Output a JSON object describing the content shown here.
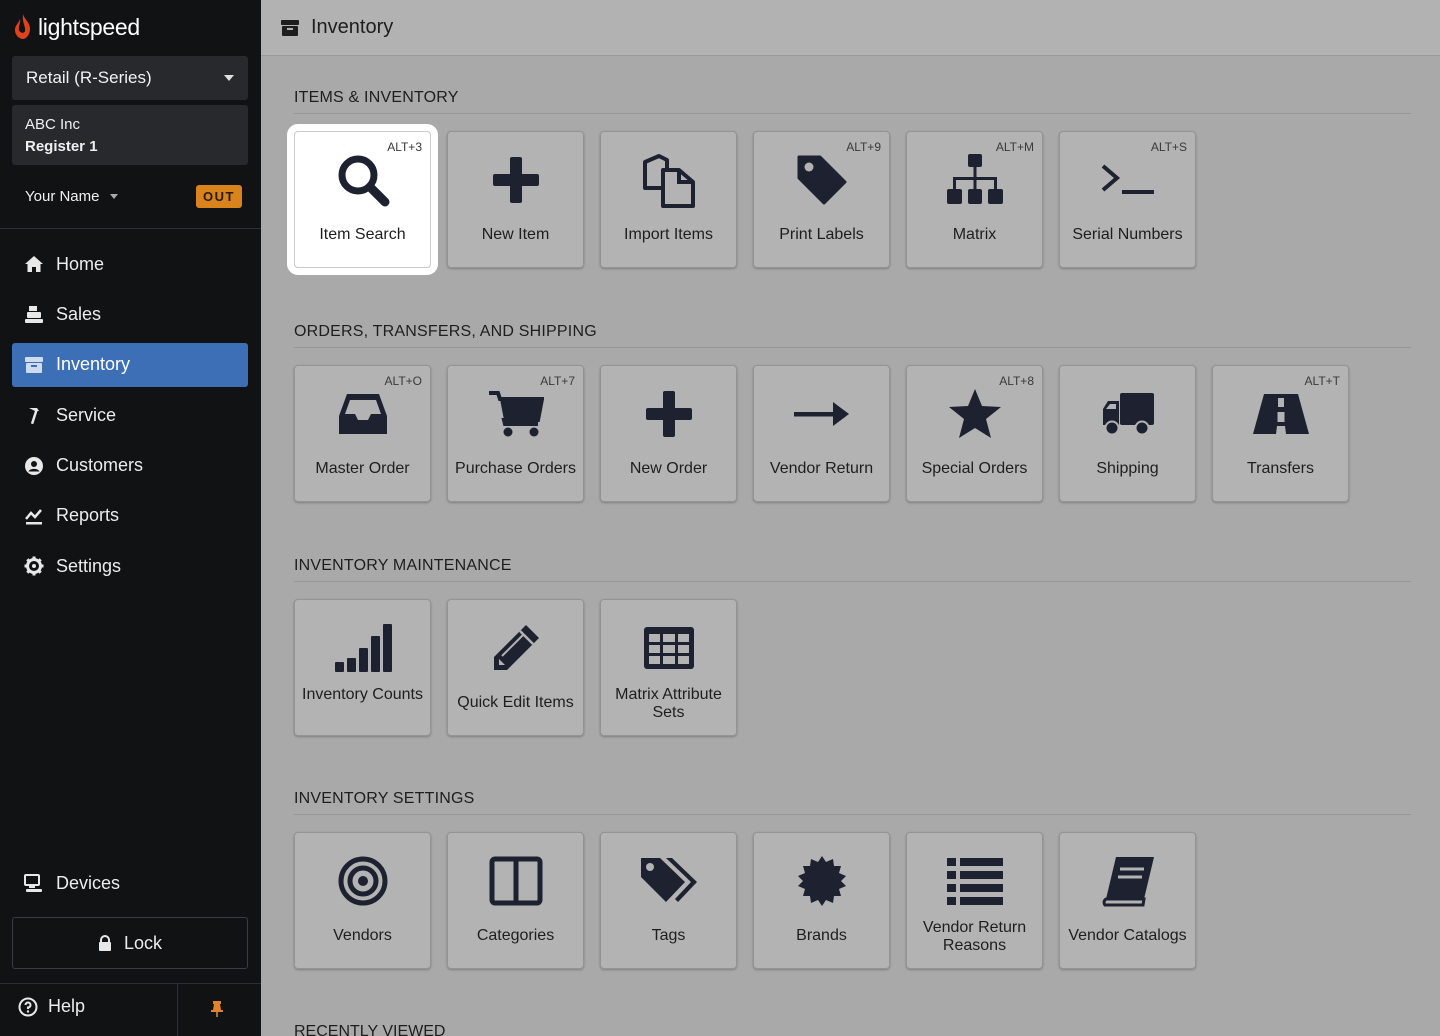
{
  "brand": {
    "name": "lightspeed",
    "accent": "#e0421e"
  },
  "sidebar": {
    "product": "Retail (R-Series)",
    "shop": "ABC Inc",
    "register": "Register 1",
    "user": "Your Name",
    "out_badge": "OUT",
    "nav": [
      {
        "label": "Home",
        "icon": "home-icon"
      },
      {
        "label": "Sales",
        "icon": "register-icon"
      },
      {
        "label": "Inventory",
        "icon": "box-icon",
        "active": true
      },
      {
        "label": "Service",
        "icon": "hammer-icon"
      },
      {
        "label": "Customers",
        "icon": "user-circle-icon"
      },
      {
        "label": "Reports",
        "icon": "chart-icon"
      },
      {
        "label": "Settings",
        "icon": "gear-icon"
      }
    ],
    "devices": "Devices",
    "lock": "Lock",
    "help": "Help"
  },
  "header": {
    "title": "Inventory"
  },
  "sections": [
    {
      "title": "ITEMS & INVENTORY",
      "tiles": [
        {
          "label": "Item Search",
          "shortcut": "ALT+3",
          "icon": "search-icon",
          "highlight": true
        },
        {
          "label": "New Item",
          "shortcut": "",
          "icon": "plus-icon"
        },
        {
          "label": "Import Items",
          "shortcut": "",
          "icon": "copy-icon"
        },
        {
          "label": "Print Labels",
          "shortcut": "ALT+9",
          "icon": "tag-icon"
        },
        {
          "label": "Matrix",
          "shortcut": "ALT+M",
          "icon": "sitemap-icon"
        },
        {
          "label": "Serial Numbers",
          "shortcut": "ALT+S",
          "icon": "terminal-icon"
        }
      ]
    },
    {
      "title": "ORDERS, TRANSFERS, AND SHIPPING",
      "tiles": [
        {
          "label": "Master Order",
          "shortcut": "ALT+O",
          "icon": "inbox-icon"
        },
        {
          "label": "Purchase Orders",
          "shortcut": "ALT+7",
          "icon": "cart-icon"
        },
        {
          "label": "New Order",
          "shortcut": "",
          "icon": "plus-icon"
        },
        {
          "label": "Vendor Return",
          "shortcut": "",
          "icon": "arrow-right-icon"
        },
        {
          "label": "Special Orders",
          "shortcut": "ALT+8",
          "icon": "star-icon"
        },
        {
          "label": "Shipping",
          "shortcut": "",
          "icon": "truck-icon"
        },
        {
          "label": "Transfers",
          "shortcut": "ALT+T",
          "icon": "road-icon"
        }
      ]
    },
    {
      "title": "INVENTORY MAINTENANCE",
      "tiles": [
        {
          "label": "Inventory Counts",
          "shortcut": "",
          "icon": "signal-icon"
        },
        {
          "label": "Quick Edit Items",
          "shortcut": "",
          "icon": "pencil-icon"
        },
        {
          "label": "Matrix Attribute Sets",
          "shortcut": "",
          "icon": "grid-icon"
        }
      ]
    },
    {
      "title": "INVENTORY SETTINGS",
      "tiles": [
        {
          "label": "Vendors",
          "shortcut": "",
          "icon": "target-icon"
        },
        {
          "label": "Categories",
          "shortcut": "",
          "icon": "columns-icon"
        },
        {
          "label": "Tags",
          "shortcut": "",
          "icon": "tags-icon"
        },
        {
          "label": "Brands",
          "shortcut": "",
          "icon": "certificate-icon"
        },
        {
          "label": "Vendor Return Reasons",
          "shortcut": "",
          "icon": "list-icon"
        },
        {
          "label": "Vendor Catalogs",
          "shortcut": "",
          "icon": "book-icon"
        }
      ]
    }
  ],
  "recent_title": "RECENTLY VIEWED"
}
